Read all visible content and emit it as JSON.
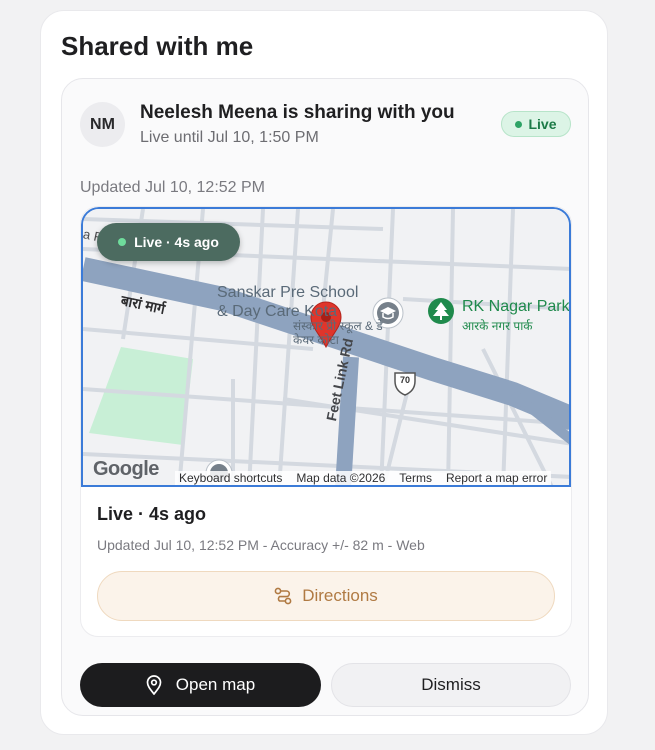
{
  "panel": {
    "title": "Shared with me"
  },
  "share": {
    "avatar_initials": "NM",
    "title": "Neelesh Meena is sharing with you",
    "subtitle": "Live until Jul 10, 1:50 PM",
    "badge": "Live",
    "updated": "Updated Jul 10, 12:52 PM"
  },
  "map": {
    "pill": "Live · 4s ago",
    "school_label_line1": "Sanskar Pre School",
    "school_label_line2": "& Day Care Kota",
    "school_label_hindi": "संस्कार प्री स्कूल & डे केयर कोटा",
    "park_label": "RK Nagar Park",
    "park_label_hindi": "आरके नगर पार्क",
    "road_label": "बारां मार्ग",
    "road_label_partial": "a Rd",
    "link_road_label": "Feet Link Rd",
    "highway_shield": "70",
    "google_logo": "Google",
    "attribution": [
      "Keyboard shortcuts",
      "Map data ©2026",
      "Terms",
      "Report a map error"
    ],
    "icons": {
      "pin": "map-pin-icon",
      "school": "school-icon",
      "park": "park-tree-icon"
    },
    "colors": {
      "pin": "#e0352b",
      "road": "#8ea3bf",
      "park": "#c8efd6",
      "border": "#3b7bd8"
    }
  },
  "detail": {
    "status": "Live · 4s ago",
    "meta": "Updated Jul 10, 12:52 PM - Accuracy +/- 82 m - Web",
    "directions_label": "Directions"
  },
  "actions": {
    "open_map_label": "Open map",
    "dismiss_label": "Dismiss"
  },
  "colors": {
    "live_green": "#2ea366",
    "primary_dark": "#1c1c1e",
    "directions_accent": "#b07a43"
  }
}
